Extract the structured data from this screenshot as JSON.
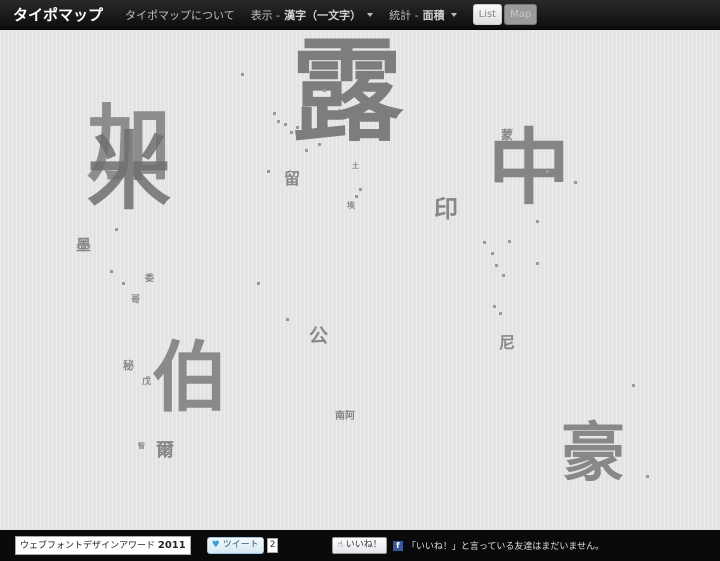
{
  "nav": {
    "brand": "タイポマップ",
    "about": "タイポマップについて",
    "display_prefix": "表示 - ",
    "display_value": "漢字（一文字）",
    "stats_prefix": "統計 - ",
    "stats_value": "面積",
    "list_label": "List",
    "map_label": "Map"
  },
  "map": {
    "glyphs": [
      {
        "char": "露",
        "size": 112
      },
      {
        "char": "加",
        "size": 84
      },
      {
        "char": "米",
        "size": 84
      },
      {
        "char": "中",
        "size": 82
      },
      {
        "char": "伯",
        "size": 76
      },
      {
        "char": "豪",
        "size": 64
      },
      {
        "char": "印",
        "size": 24
      },
      {
        "char": "公",
        "size": 19
      },
      {
        "char": "尼",
        "size": 16
      },
      {
        "char": "爾",
        "size": 18
      },
      {
        "char": "留",
        "size": 16
      },
      {
        "char": "墨",
        "size": 15
      },
      {
        "char": "蒙",
        "size": 12
      },
      {
        "char": "秘",
        "size": 11
      },
      {
        "char": "南阿",
        "size": 10
      },
      {
        "char": "戊",
        "size": 9
      },
      {
        "char": "委",
        "size": 9
      },
      {
        "char": "哥",
        "size": 9
      },
      {
        "char": "埃",
        "size": 8
      },
      {
        "char": "土",
        "size": 7
      },
      {
        "char": "智",
        "size": 7
      }
    ]
  },
  "footer": {
    "award": "ウェブフォントデザインアワード",
    "award_year": "2011",
    "tweet_label": "ツイート",
    "tweet_count": "2",
    "like_label": "いいね！",
    "fb_icon": "f",
    "fb_text": "「いいね！」と言っている友達はまだいません。"
  }
}
